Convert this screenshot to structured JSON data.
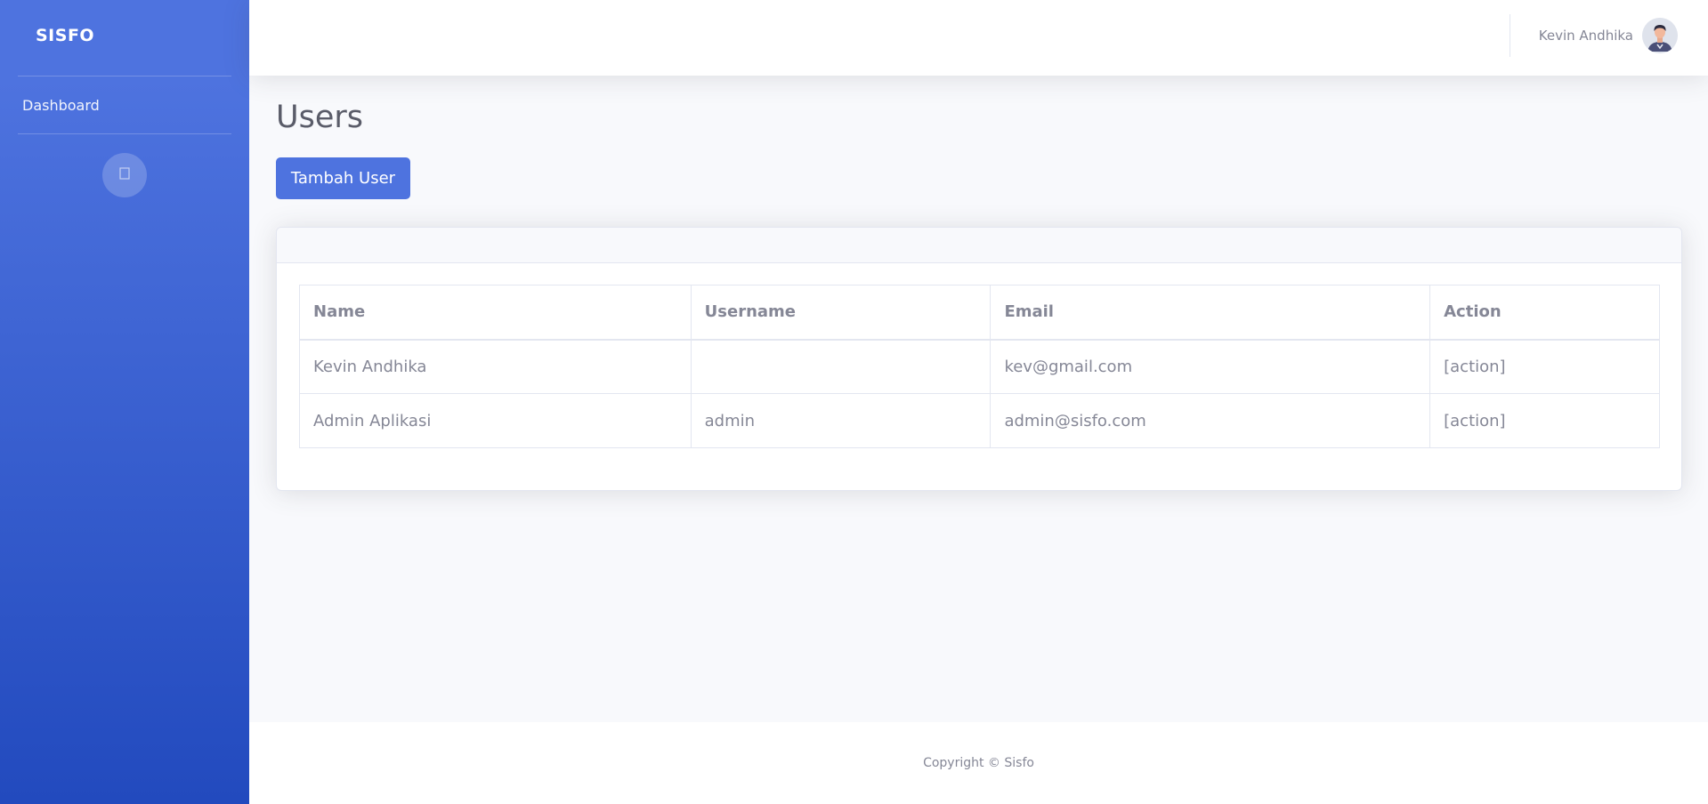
{
  "sidebar": {
    "brand": "SISFO",
    "items": [
      {
        "label": "Dashboard"
      }
    ],
    "toggle_icon": "chevron-left-icon"
  },
  "topbar": {
    "user_name": "Kevin Andhika",
    "avatar_icon": "user-avatar-icon"
  },
  "main": {
    "title": "Users",
    "add_button": "Tambah User",
    "table": {
      "headers": [
        "Name",
        "Username",
        "Email",
        "Action"
      ],
      "rows": [
        {
          "name": "Kevin Andhika",
          "username": "",
          "email": "kev@gmail.com",
          "action": "[action]"
        },
        {
          "name": "Admin Aplikasi",
          "username": "admin",
          "email": "admin@sisfo.com",
          "action": "[action]"
        }
      ]
    }
  },
  "footer": {
    "copyright": "Copyright © Sisfo"
  },
  "colors": {
    "primary": "#4e73df",
    "primary_dark": "#224abe",
    "text_muted": "#858796"
  }
}
